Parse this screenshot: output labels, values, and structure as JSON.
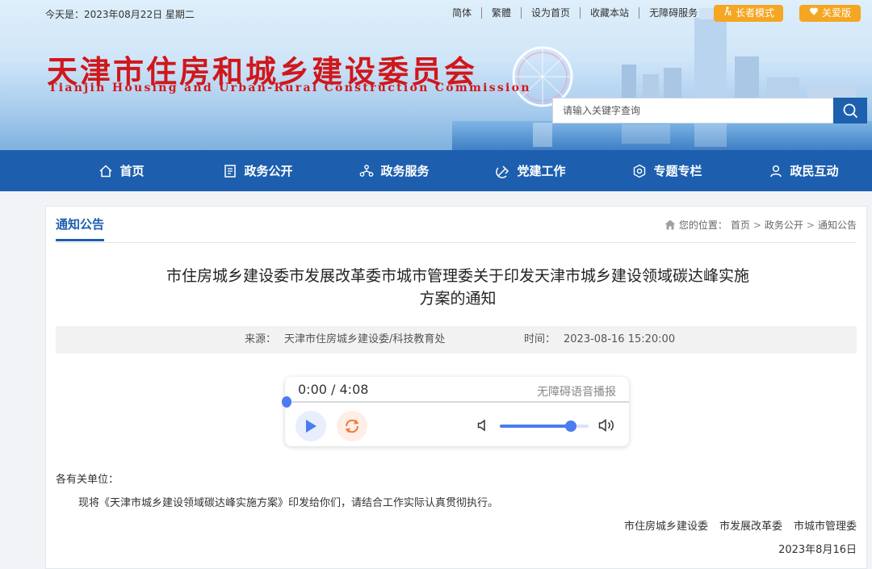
{
  "topbar": {
    "today": "今天是：2023年08月22日 星期二",
    "links": [
      "简体",
      "繁體",
      "设为首页",
      "收藏本站",
      "无障碍服务"
    ],
    "elder_mode": "长者模式",
    "care_mode": "关爱版"
  },
  "header": {
    "title_cn": "天津市住房和城乡建设委员会",
    "title_en": "Tianjin Housing and Urban-Rural Construction Commission"
  },
  "search": {
    "placeholder": "请输入关键字查询",
    "value": ""
  },
  "nav": {
    "items": [
      {
        "label": "首页",
        "icon": "home-icon"
      },
      {
        "label": "政务公开",
        "icon": "document-icon"
      },
      {
        "label": "政务服务",
        "icon": "service-icon"
      },
      {
        "label": "党建工作",
        "icon": "party-icon"
      },
      {
        "label": "专题专栏",
        "icon": "topic-icon"
      },
      {
        "label": "政民互动",
        "icon": "user-icon"
      }
    ]
  },
  "section": {
    "title": "通知公告",
    "breadcrumb": {
      "prefix": "您的位置：",
      "items": [
        "首页",
        "政务公开",
        "通知公告"
      ],
      "sep": ">"
    }
  },
  "article": {
    "title_line1": "市住房城乡建设委市发展改革委市城市管理委关于印发天津市城乡建设领域碳达峰实施",
    "title_line2": "方案的通知",
    "source_label": "来源：",
    "source": "天津市住房城乡建设委/科技教育处",
    "time_label": "时间：",
    "time": "2023-08-16 15:20:00",
    "greeting": "各有关单位：",
    "body": "现将《天津市城乡建设领域碳达峰实施方案》印发给你们，请结合工作实际认真贯彻执行。",
    "signers": [
      "市住房城乡建设委",
      "市发展改革委",
      "市城市管理委"
    ],
    "date": "2023年8月16日"
  },
  "player": {
    "time": "0:00 / 4:08",
    "label": "无障碍语音播报",
    "progress": 0,
    "volume": 0.8,
    "accent": "#4b7cf0"
  },
  "colors": {
    "nav_bg": "#1d5fae",
    "brand_red": "#d0171b",
    "mode_btn": "#f5a623"
  }
}
